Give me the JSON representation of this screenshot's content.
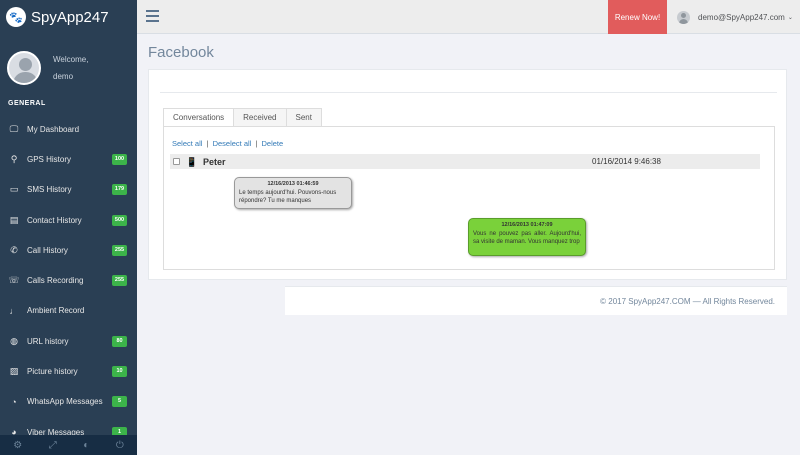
{
  "brand": {
    "name": "SpyApp247",
    "logo_icon": "paw-icon"
  },
  "profile": {
    "welcome": "Welcome,",
    "username": "demo"
  },
  "sidebar": {
    "section_title": "GENERAL",
    "items": [
      {
        "label": "My Dashboard",
        "icon": "monitor-icon",
        "glyph": "🖵",
        "badge": ""
      },
      {
        "label": "GPS History",
        "icon": "map-marker-icon",
        "glyph": "⚲",
        "badge": "100"
      },
      {
        "label": "SMS History",
        "icon": "chat-icon",
        "glyph": "▭",
        "badge": "179"
      },
      {
        "label": "Contact History",
        "icon": "address-book-icon",
        "glyph": "▤",
        "badge": "500"
      },
      {
        "label": "Call History",
        "icon": "phone-icon",
        "glyph": "✆",
        "badge": "255"
      },
      {
        "label": "Calls Recording",
        "icon": "phone-recording-icon",
        "glyph": "☏",
        "badge": "255"
      },
      {
        "label": "Ambient Record",
        "icon": "microphone-icon",
        "glyph": "♩",
        "badge": ""
      },
      {
        "label": "URL history",
        "icon": "globe-icon",
        "glyph": "◍",
        "badge": "80"
      },
      {
        "label": "Picture history",
        "icon": "picture-icon",
        "glyph": "▨",
        "badge": "10"
      },
      {
        "label": "WhatsApp Messages",
        "icon": "whatsapp-icon",
        "glyph": "◔",
        "badge": "5"
      },
      {
        "label": "Viber Messages",
        "icon": "viber-icon",
        "glyph": "◕",
        "badge": "1"
      }
    ],
    "footer_icons": [
      "settings-icon",
      "fullscreen-icon",
      "eye-slash-icon",
      "power-icon"
    ],
    "footer_glyphs": [
      "⚙",
      "⤢",
      "◐",
      "⏻"
    ]
  },
  "topnav": {
    "renew_label": "Renew Now!",
    "user_email": "demo@SpyApp247.com",
    "caret": "⌄"
  },
  "page": {
    "title": "Facebook"
  },
  "tabs": [
    {
      "label": "Conversations",
      "active": true
    },
    {
      "label": "Received",
      "active": false
    },
    {
      "label": "Sent",
      "active": false
    }
  ],
  "actions": {
    "select_all": "Select all",
    "deselect_all": "Deselect all",
    "delete": "Delete",
    "separator": "|"
  },
  "conversation": {
    "contact": "Peter",
    "date": "01/16/2014 9:46:38",
    "messages": [
      {
        "direction": "received",
        "time": "12/16/2013 01:46:59",
        "text": "Le temps aujourd'hui. Pouvons-nous répondre? Tu me manques"
      },
      {
        "direction": "sent",
        "time": "12/16/2013 01:47:09",
        "text": "Vous ne pouvez pas aller. Aujourd'hui, sa visite de maman. Vous manquez trop"
      }
    ]
  },
  "footer": {
    "text": "© 2017 SpyApp247.COM — All Rights Reserved."
  }
}
